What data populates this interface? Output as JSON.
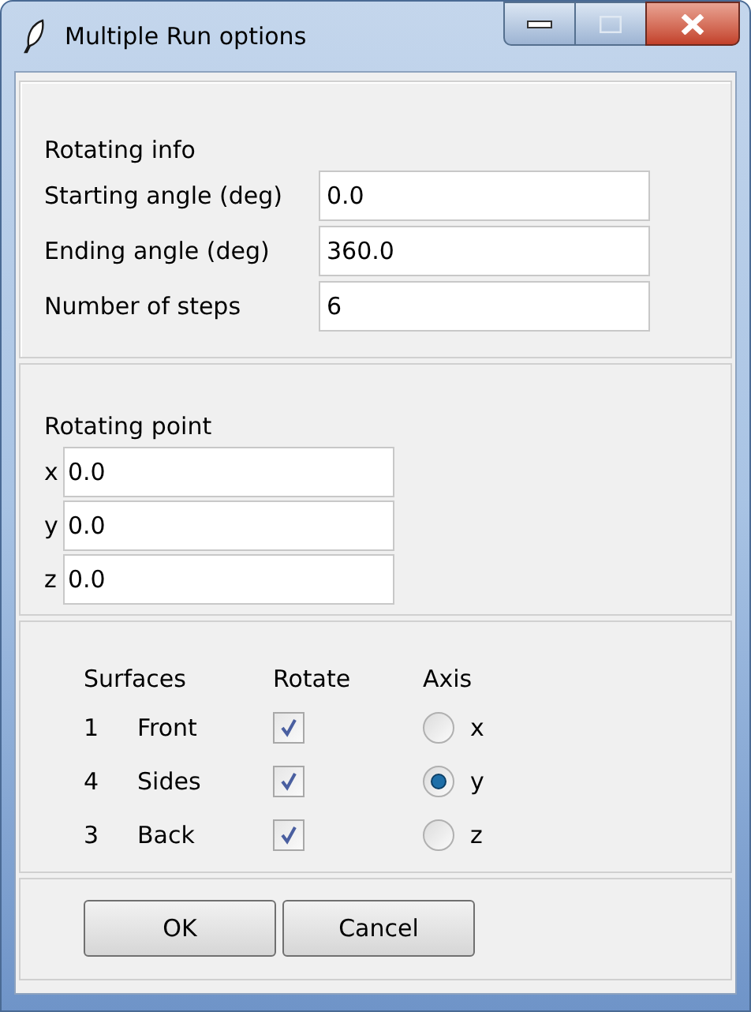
{
  "window": {
    "title": "Multiple Run options"
  },
  "rotating_info": {
    "heading": "Rotating info",
    "fields": [
      {
        "label": "Starting angle (deg)",
        "value": "0.0"
      },
      {
        "label": "Ending angle (deg)",
        "value": "360.0"
      },
      {
        "label": "Number of steps",
        "value": "6"
      }
    ]
  },
  "rotating_point": {
    "heading": "Rotating point",
    "fields": [
      {
        "label": "x",
        "value": "0.0"
      },
      {
        "label": "y",
        "value": "0.0"
      },
      {
        "label": "z",
        "value": "0.0"
      }
    ]
  },
  "surfaces": {
    "columns": [
      "Surfaces",
      "Rotate",
      "Axis"
    ],
    "rows": [
      {
        "number": "1",
        "name": "Front",
        "rotate_checked": true,
        "axis": {
          "label": "x",
          "selected": false
        }
      },
      {
        "number": "4",
        "name": "Sides",
        "rotate_checked": true,
        "axis": {
          "label": "y",
          "selected": true
        }
      },
      {
        "number": "3",
        "name": "Back",
        "rotate_checked": true,
        "axis": {
          "label": "z",
          "selected": false
        }
      }
    ]
  },
  "buttons": [
    "OK",
    "Cancel"
  ]
}
